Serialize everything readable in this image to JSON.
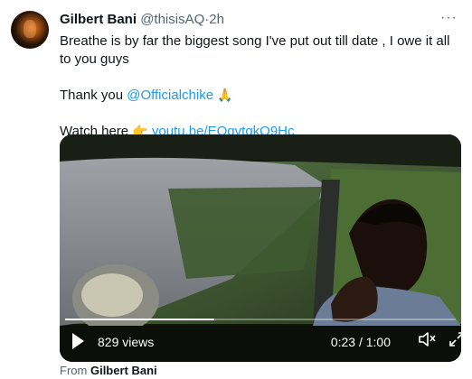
{
  "tweet": {
    "name": "Gilbert Bani",
    "handle": "@thisisAQ",
    "separator": "·",
    "time": "2h",
    "more_icon": "···",
    "line1": "Breathe is by far the biggest song I've put out till date , I owe it all to you guys",
    "thanks_prefix": "Thank you ",
    "mention": "@Officialchike",
    "pray_emoji": "🙏",
    "watch_prefix": "Watch here ",
    "point_emoji": "👉",
    "link": "youtu.be/EOqvtqkO9Hc"
  },
  "video": {
    "views": "829 views",
    "timecode": "0:23 / 1:00",
    "progress": 0.383,
    "play_icon": "play-icon",
    "volume_icon": "volume-icon",
    "fullscreen_icon": "fullscreen-icon"
  },
  "attribution": {
    "prefix": "From",
    "name": "Gilbert Bani"
  }
}
